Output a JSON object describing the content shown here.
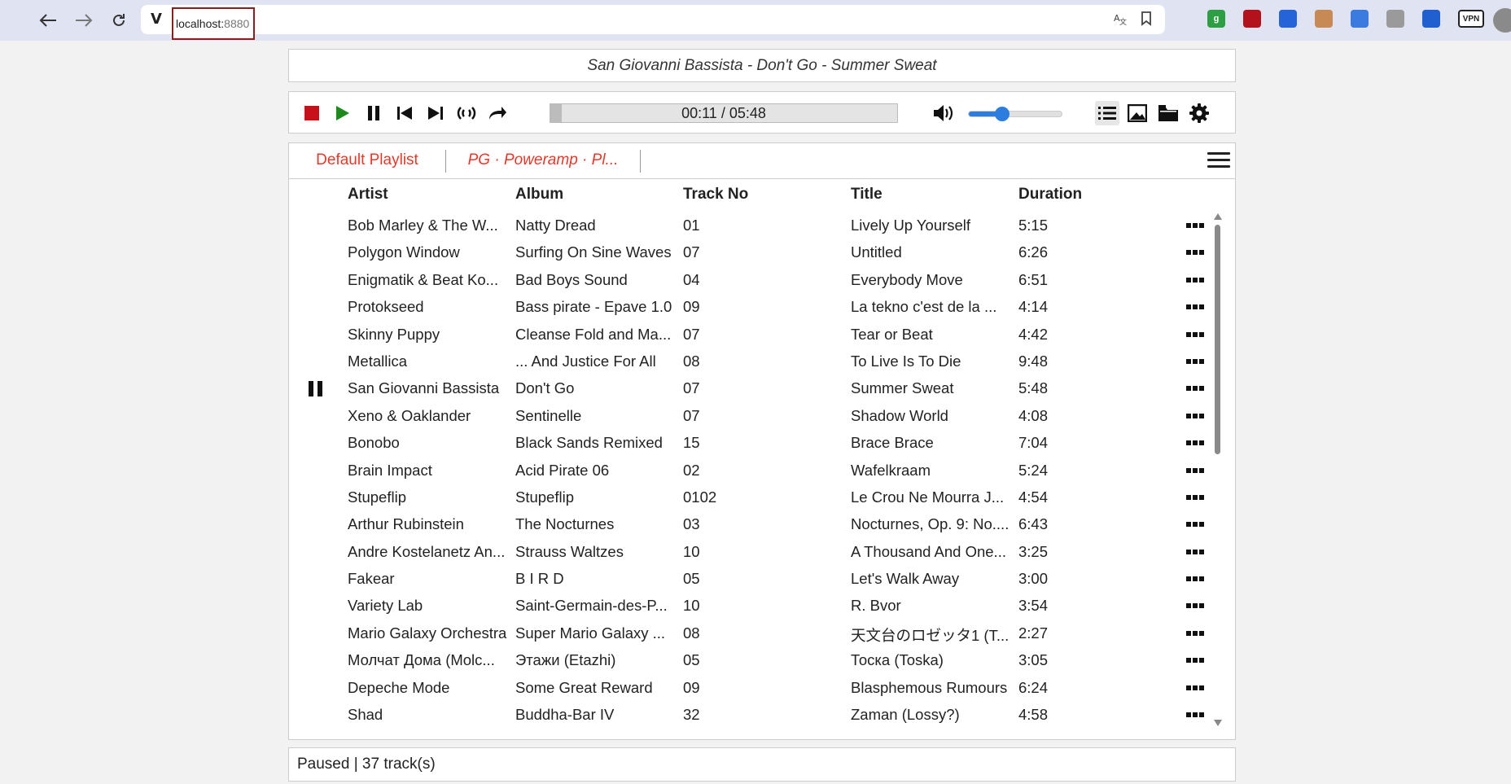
{
  "browser": {
    "url_host": "localhost:",
    "url_port": "8880",
    "site_icon": "V",
    "extensions": [
      {
        "name": "grammarly-ext-icon",
        "label": "g",
        "color": "#2e9e44"
      },
      {
        "name": "ublock-ext-icon",
        "label": "",
        "color": "#b3111b"
      },
      {
        "name": "link-ext-icon",
        "label": "",
        "color": "#2563d9"
      },
      {
        "name": "face-ext-icon",
        "label": "",
        "color": "#c88a55"
      },
      {
        "name": "puzzle-ext-icon",
        "label": "",
        "color": "#3b7be0"
      },
      {
        "name": "cast-ext-icon",
        "label": "",
        "color": "#9a9a9a"
      },
      {
        "name": "bitwarden-ext-icon",
        "label": "",
        "color": "#1f5fcf"
      },
      {
        "name": "vpn-ext-icon",
        "label": "VPN",
        "color": "#222222"
      }
    ]
  },
  "now_playing": "San Giovanni Bassista - Don't Go - Summer Sweat",
  "player": {
    "time": "00:11 / 05:48",
    "progress_fraction": 0.033,
    "volume_fraction": 0.36,
    "colors": {
      "stop": "#c8101a",
      "play": "#1e8a1e",
      "volume": "#2b7de0"
    }
  },
  "tabs": [
    {
      "label": "Default Playlist"
    },
    {
      "label": "PG · Poweramp · Pl..."
    }
  ],
  "columns": {
    "artist": "Artist",
    "album": "Album",
    "track": "Track No",
    "title": "Title",
    "duration": "Duration"
  },
  "rows": [
    {
      "artist": "Bob Marley & The W...",
      "album": "Natty Dread",
      "track": "01",
      "title": "Lively Up Yourself",
      "duration": "5:15",
      "state": ""
    },
    {
      "artist": "Polygon Window",
      "album": "Surfing On Sine Waves",
      "track": "07",
      "title": "Untitled",
      "duration": "6:26",
      "state": ""
    },
    {
      "artist": "Enigmatik & Beat Ko...",
      "album": "Bad Boys Sound",
      "track": "04",
      "title": "Everybody Move",
      "duration": "6:51",
      "state": ""
    },
    {
      "artist": "Protokseed",
      "album": "Bass pirate - Epave 1.0",
      "track": "09",
      "title": "La tekno c'est de la ...",
      "duration": "4:14",
      "state": ""
    },
    {
      "artist": "Skinny Puppy",
      "album": "Cleanse Fold and Ma...",
      "track": "07",
      "title": "Tear or Beat",
      "duration": "4:42",
      "state": ""
    },
    {
      "artist": "Metallica",
      "album": "... And Justice For All",
      "track": "08",
      "title": "To Live Is To Die",
      "duration": "9:48",
      "state": ""
    },
    {
      "artist": "San Giovanni Bassista",
      "album": "Don't Go",
      "track": "07",
      "title": "Summer Sweat",
      "duration": "5:48",
      "state": "paused"
    },
    {
      "artist": "Xeno & Oaklander",
      "album": "Sentinelle",
      "track": "07",
      "title": "Shadow World",
      "duration": "4:08",
      "state": ""
    },
    {
      "artist": "Bonobo",
      "album": "Black Sands Remixed",
      "track": "15",
      "title": "Brace Brace",
      "duration": "7:04",
      "state": ""
    },
    {
      "artist": "Brain Impact",
      "album": "Acid Pirate 06",
      "track": "02",
      "title": "Wafelkraam",
      "duration": "5:24",
      "state": ""
    },
    {
      "artist": "Stupeflip",
      "album": "Stupeflip",
      "track": "0102",
      "title": "Le Crou Ne Mourra J...",
      "duration": "4:54",
      "state": ""
    },
    {
      "artist": "Arthur Rubinstein",
      "album": "The Nocturnes",
      "track": "03",
      "title": "Nocturnes, Op. 9: No....",
      "duration": "6:43",
      "state": ""
    },
    {
      "artist": "Andre Kostelanetz An...",
      "album": "Strauss Waltzes",
      "track": "10",
      "title": "A Thousand And One...",
      "duration": "3:25",
      "state": ""
    },
    {
      "artist": "Fakear",
      "album": "B I R D",
      "track": "05",
      "title": "Let's Walk Away",
      "duration": "3:00",
      "state": ""
    },
    {
      "artist": "Variety Lab",
      "album": "Saint-Germain-des-P...",
      "track": "10",
      "title": "R. Bvor",
      "duration": "3:54",
      "state": ""
    },
    {
      "artist": "Mario Galaxy Orchestra",
      "album": "Super Mario Galaxy ...",
      "track": "08",
      "title": "天文台のロゼッタ1 (T...",
      "duration": "2:27",
      "state": ""
    },
    {
      "artist": "Молчат Дома (Molc...",
      "album": "Этажи (Etazhi)",
      "track": "05",
      "title": "Тоска (Toska)",
      "duration": "3:05",
      "state": ""
    },
    {
      "artist": "Depeche Mode",
      "album": "Some Great Reward",
      "track": "09",
      "title": "Blasphemous Rumours",
      "duration": "6:24",
      "state": ""
    },
    {
      "artist": "Shad",
      "album": "Buddha-Bar IV",
      "track": "32",
      "title": "Zaman (Lossy?)",
      "duration": "4:58",
      "state": ""
    }
  ],
  "status": "Paused | 37 track(s)"
}
